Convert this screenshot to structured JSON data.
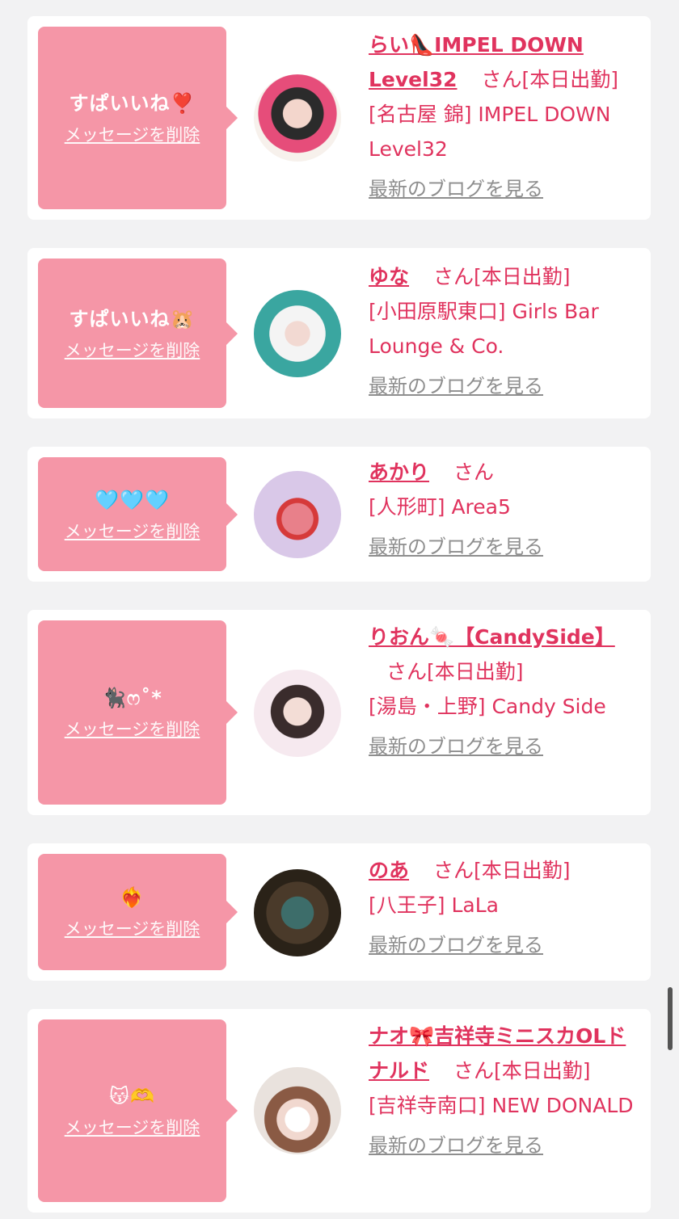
{
  "delete_label": "メッセージを削除",
  "blog_label": "最新のブログを見る",
  "san_label": "さん",
  "cards": [
    {
      "message": "すぱいいね❣️",
      "name": "らい👠IMPEL DOWN Level32",
      "status": "[本日出勤]",
      "location": "[名古屋 錦] IMPEL DOWN Level32"
    },
    {
      "message": "すぱいいね🐹",
      "name": "ゆな",
      "status": "[本日出勤]",
      "location": "[小田原駅東口] Girls Bar Lounge & Co."
    },
    {
      "message": "🩵🩵🩵",
      "name": "あかり",
      "status": "",
      "location": "[人形町] Area5"
    },
    {
      "message": "🐈‍⬛ෆ˚*",
      "name": "りおん🍬【CandySide】",
      "status": "[本日出勤]",
      "location": "[湯島・上野] Candy Side"
    },
    {
      "message": "❤️‍🔥",
      "name": "のあ",
      "status": "[本日出勤]",
      "location": "[八王子] LaLa"
    },
    {
      "message": "😽🫶",
      "name": "ナオ🎀吉祥寺ミニスカOLドナルド",
      "status": "[本日出勤]",
      "location": "[吉祥寺南口] NEW DONALD"
    }
  ],
  "colors": {
    "accent": "#e0335e",
    "bubble": "#f596a7",
    "muted": "#8e8e8e",
    "background": "#f2f2f3"
  }
}
